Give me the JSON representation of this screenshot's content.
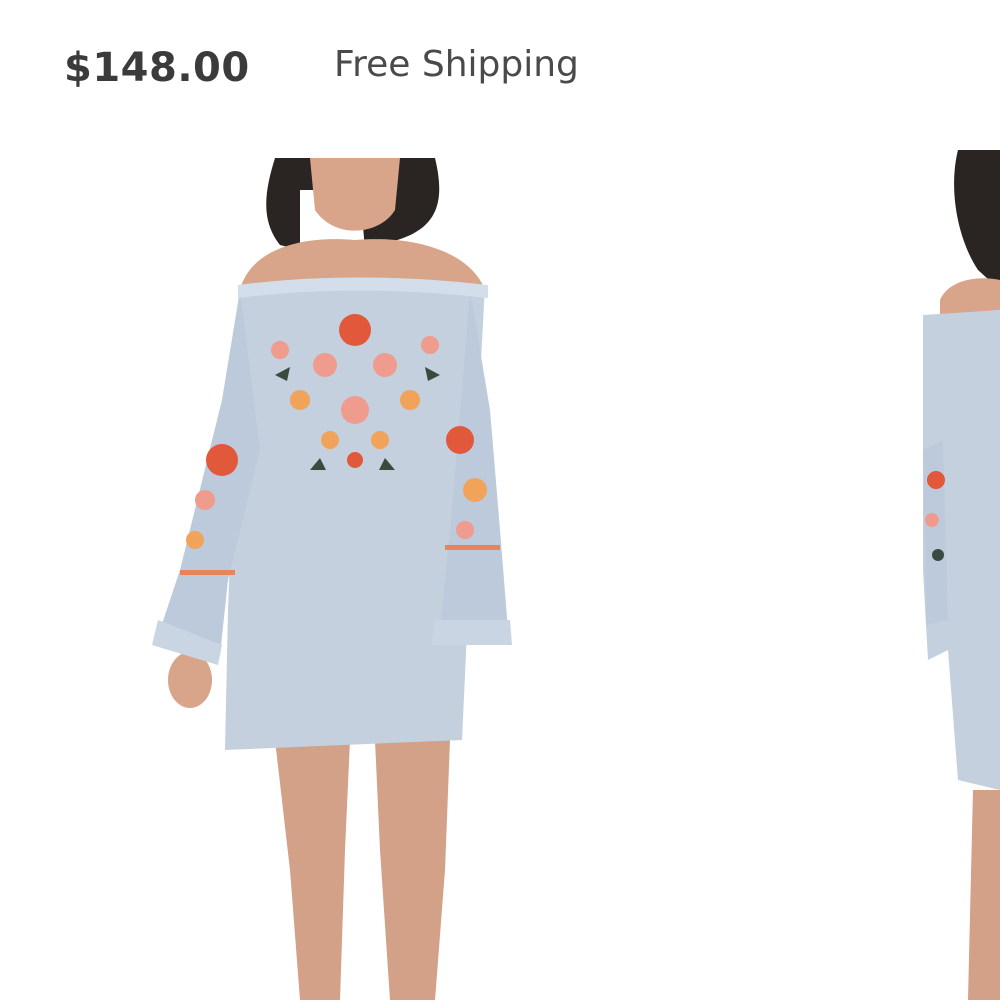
{
  "product": {
    "price": "$148.00",
    "shipping": "Free Shipping"
  },
  "gallery": {
    "images": [
      {
        "name": "dress-photo-front"
      },
      {
        "name": "dress-photo-side"
      }
    ]
  },
  "colors": {
    "dress": "#c4d0de",
    "skin": "#d8a48a",
    "hair": "#2a2522",
    "embroidery_red": "#e2583a",
    "embroidery_pink": "#ef9b8e",
    "embroidery_orange": "#f2a35a",
    "embroidery_green": "#3a4a3e"
  }
}
